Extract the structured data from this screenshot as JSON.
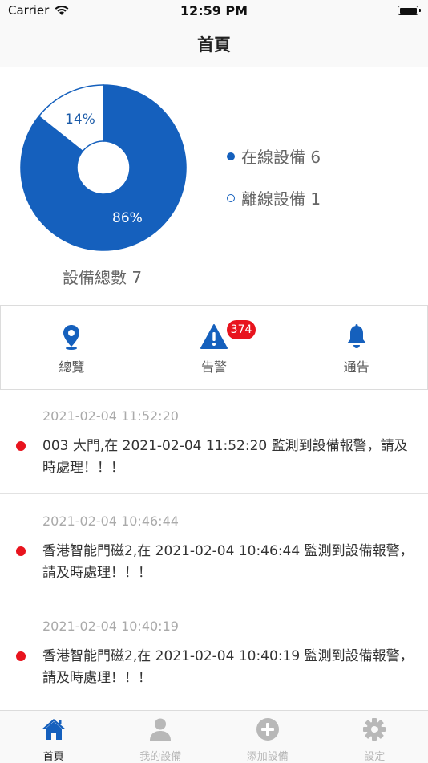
{
  "status_bar": {
    "carrier": "Carrier",
    "time": "12:59 PM"
  },
  "nav": {
    "title": "首頁"
  },
  "chart_data": {
    "type": "pie",
    "categories": [
      "在線設備",
      "離線設備"
    ],
    "values": [
      6,
      1
    ],
    "percent_labels": [
      "86%",
      "14%"
    ],
    "colors": [
      "#1560bd",
      "#ffffff"
    ]
  },
  "legend": {
    "online": "在線設備 6",
    "offline": "離線設備 1"
  },
  "total": "設備總數 7",
  "quick_actions": [
    {
      "label": "總覽",
      "icon": "location-pin-icon"
    },
    {
      "label": "告警",
      "icon": "warning-icon",
      "badge": "374"
    },
    {
      "label": "通告",
      "icon": "bell-icon"
    }
  ],
  "alerts": [
    {
      "time": "2021-02-04 11:52:20",
      "message": "003 大門,在 2021-02-04 11:52:20 監測到設備報警，請及時處理！！！"
    },
    {
      "time": "2021-02-04 10:46:44",
      "message": "香港智能門磁2,在 2021-02-04 10:46:44 監測到設備報警，請及時處理！！！"
    },
    {
      "time": "2021-02-04 10:40:19",
      "message": "香港智能門磁2,在 2021-02-04 10:40:19 監測到設備報警，請及時處理！！！"
    }
  ],
  "tabs": [
    {
      "label": "首頁",
      "icon": "home-icon",
      "active": true
    },
    {
      "label": "我的設備",
      "icon": "user-icon",
      "active": false
    },
    {
      "label": "添加設備",
      "icon": "plus-circle-icon",
      "active": false
    },
    {
      "label": "設定",
      "icon": "gear-icon",
      "active": false
    }
  ],
  "colors": {
    "accent": "#1560bd",
    "alert_red": "#e8141e",
    "inactive_tab": "#b8b8b8"
  }
}
